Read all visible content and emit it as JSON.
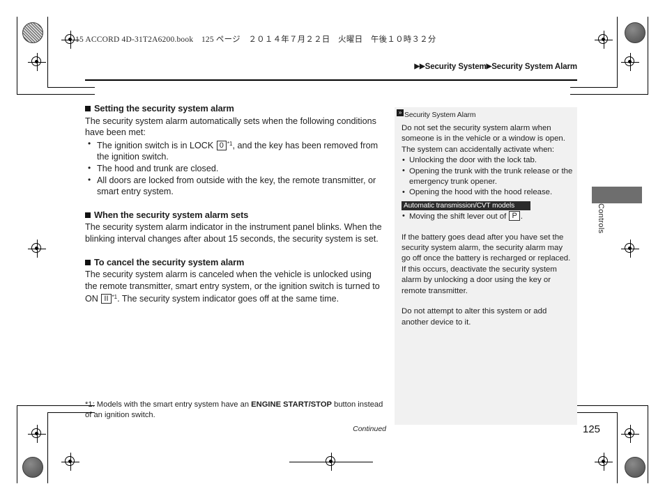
{
  "print": {
    "file_header": "15 ACCORD 4D-31T2A6200.book　125 ページ　２０１４年７月２２日　火曜日　午後１０時３２分"
  },
  "breadcrumb": {
    "arrow_double": "▶▶",
    "arrow_single": "▶",
    "level1": "Security System",
    "level2": "Security System Alarm"
  },
  "main": {
    "sections": [
      {
        "heading": "Setting the security system alarm",
        "intro": "The security system alarm automatically sets when the following conditions have been met:",
        "bullets": {
          "b1_pre": "The ignition switch is in LOCK",
          "b1_key": "0",
          "b1_fn": "*1",
          "b1_post": ", and the key has been removed from the ignition switch.",
          "b2": "The hood and trunk are closed.",
          "b3": "All doors are locked from outside with the key, the remote transmitter, or smart entry system."
        }
      },
      {
        "heading": "When the security system alarm sets",
        "body": "The security system alarm indicator in the instrument panel blinks. When the blinking interval changes after about 15 seconds, the security system is set."
      },
      {
        "heading": "To cancel the security system alarm",
        "body_pre": "The security system alarm is canceled when the vehicle is unlocked using the remote transmitter, smart entry system, or the ignition switch is turned to ON",
        "body_key": "II",
        "body_fn": "*1",
        "body_post": ". The security system indicator goes off at the same time."
      }
    ],
    "footnote_pre": "*1: Models with the smart entry system have an ",
    "footnote_bold": "ENGINE START/STOP",
    "footnote_post": " button instead of an ignition switch.",
    "continued": "Continued"
  },
  "side_panel": {
    "icon": "»",
    "title": "Security System Alarm",
    "p1": "Do not set the security system alarm when someone is in the vehicle or a window is open. The system can accidentally activate when:",
    "bullets": [
      "Unlocking the door with the lock tab.",
      "Opening the trunk with the trunk release or the emergency trunk opener.",
      "Opening the hood with the hood release."
    ],
    "tag": "Automatic transmission/CVT models",
    "tag_bullet_pre": "Moving the shift lever out of",
    "tag_bullet_key": "P",
    "tag_bullet_post": ".",
    "p2": "If the battery goes dead after you have set the security system alarm, the security alarm may go off once the battery is recharged or replaced.",
    "p3": "If this occurs, deactivate the security system alarm by unlocking a door using the key or remote transmitter.",
    "p4": "Do not attempt to alter this system or add another device to it."
  },
  "thumb_tab": {
    "label": "Controls"
  },
  "page_number": "125",
  "colors": {
    "panel_bg": "#f1f1f1",
    "tag_bg": "#2b2b2b",
    "thumb_tab": "#6e6e6e",
    "rule": "#000000"
  }
}
